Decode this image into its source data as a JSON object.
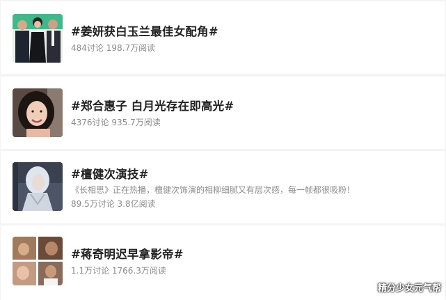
{
  "topics": [
    {
      "title": "#姜妍获白玉兰最佳女配角#",
      "meta": "484讨论 198.7万阅读",
      "thumb_icon": "three-people-photo"
    },
    {
      "title": "#郑合惠子 白月光存在即高光#",
      "meta": "4376讨论 935.7万阅读",
      "thumb_icon": "smiling-woman-photo"
    },
    {
      "title": "#檀健次演技#",
      "description": "《长相思》正在热播，檀健次饰演的相柳细腻又有层次感，每一帧都很吸粉！",
      "meta": "89.5万讨论 3.8亿阅读",
      "thumb_icon": "white-haired-character-photo"
    },
    {
      "title": "#蒋奇明迟早拿影帝#",
      "meta": "1.1万讨论 1766.3万阅读",
      "thumb_icon": "four-stills-collage"
    }
  ],
  "watermark": "精分少女元气帮"
}
